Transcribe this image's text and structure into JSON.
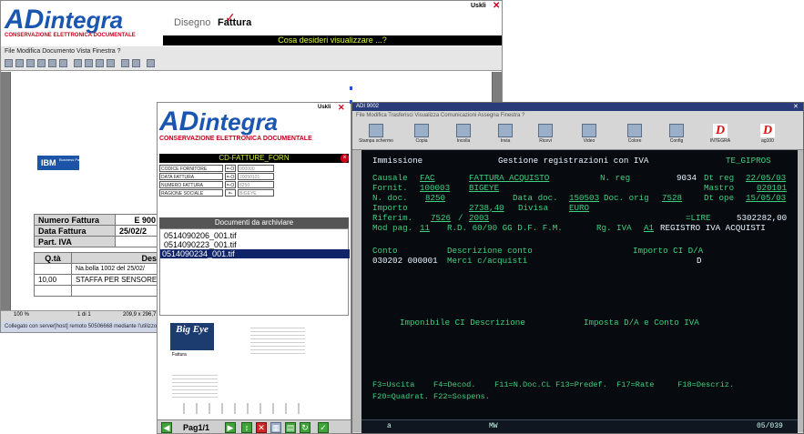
{
  "logo": {
    "brand_a": "AD",
    "brand_b": "integra",
    "tagline": "CONSERVAZIONE ELETTRONICA DOCUMENTALE"
  },
  "viewer": {
    "close_label": "Uskli",
    "tab_disegno": "Disegno",
    "tab_fattura": "Fattura",
    "prompt": "Cosa desideri visualizzare ...?",
    "menu": "File  Modifica  Documento  Vista  Finestra  ?",
    "zoom": "100 %",
    "page_counter": "1 di 1",
    "page_size": "209,9 x 296,7 mm",
    "status": "Collegato con server[host] remoto 50506668 mediante l'utilizzo del",
    "company_logo": "IBM",
    "company_sub": "Business Partner",
    "invoice": {
      "numero_label": "Numero Fattura",
      "numero_value": "E 900",
      "data_label": "Data Fattura",
      "data_value": "25/02/2",
      "iva_label": "Part. IVA",
      "qta_header": "Q.tà",
      "desc_header": "Descri",
      "row1_desc": "Na.bolla  1002  del 25/02/",
      "row2_qty": "10,00",
      "row2_desc": "STAFFA PER SENSORE"
    }
  },
  "archive": {
    "close_label": "Uskli",
    "fields_title": "CD-FATTURE_FORN",
    "fields": [
      {
        "label": "CODICE FORNITORE",
        "op": "=-O",
        "value": "000000"
      },
      {
        "label": "DATA FATTURA",
        "op": "=-O",
        "value": "20050101"
      },
      {
        "label": "NUMERO FATTURA",
        "op": "=-O",
        "value": "8250"
      },
      {
        "label": "RAGIONE SOCIALE",
        "op": "=-",
        "value": "BIGEYE"
      }
    ],
    "docs_title": "Documenti da archiviare",
    "docs": [
      "0514090206_001.tif",
      "0514090223_001.tif",
      "0514090234_001.tif"
    ],
    "thumb_logo": "Big Eye",
    "thumb_sub": "Fattura",
    "pager": "Pag1/1"
  },
  "terminal": {
    "window_title": "ADI 9002",
    "menu": "File  Modifica  Trasferisci  Visualizza  Comunicazioni  Assegna  Finestra  ?",
    "tools": [
      "Stampa schermo",
      "Copia",
      "Incolla",
      "Invia",
      "Ricevi",
      "Video",
      "Colore",
      "Config",
      "INTEGRA",
      "ag100"
    ],
    "header_left": "Immissione",
    "header_center": "Gestione registrazioni con IVA",
    "header_right": "TE_GIPROS",
    "causale_label": "Causale",
    "causale_value": "FAC",
    "causale_desc": "FATTURA ACQUISTO",
    "nreg_label": "N. reg",
    "nreg_value": "9034",
    "dtreg_label": "Dt reg",
    "dtreg_value": "22/05/03",
    "fornit_label": "Fornit.",
    "fornit_code": "100003",
    "fornit_name": "BIGEYE",
    "mastro_label": "Mastro",
    "mastro_value": "020101",
    "ndoc_label": "N. doc.",
    "ndoc_value": "8250",
    "datadoc_label": "Data doc.",
    "datadoc_value": "150503",
    "docorig_label": "Doc. orig",
    "docorig_value": "7528",
    "dtope_label": "Dt ope",
    "dtope_value": "15/05/03",
    "importo_label": "Importo",
    "importo_value": "2738,40",
    "divisa_label": "Divisa",
    "divisa_value": "EURO",
    "riferim_label": "Riferim.",
    "riferim_a": "7526",
    "riferim_sep": "/",
    "riferim_b": "2003",
    "lire_label": "=LIRE",
    "lire_value": "5302282,00",
    "modpag_label": "Mod pag.",
    "modpag_value": "11",
    "modpag_desc": "R.D. 60/90 GG D.F. F.M.",
    "rgiva_label": "Rg. IVA",
    "rgiva_value": "A1",
    "rgiva_desc": "REGISTRO IVA ACQUISTI",
    "col_conto": "Conto",
    "col_desc": "Descrizione conto",
    "col_importo": "Importo CI D/A",
    "row_conto": "030202 000001",
    "row_desc": "Merci c/acquisti",
    "row_da": "D",
    "sub_header_left": "Imponibile CI Descrizione",
    "sub_header_right": "Imposta D/A e Conto IVA",
    "fkeys_1": "F3=Uscita    F4=Decod.    F11=N.Doc.CL F13=Predef.  F17=Rate     F18=Descriz.",
    "fkeys_2": "F20=Quadrat. F22=Sospens.",
    "status_left": "a",
    "status_mid": "MW",
    "status_right": "05/039"
  },
  "colors": {
    "brand_blue": "#1a56b0",
    "brand_red": "#c8001c",
    "term_bg": "#070b10",
    "term_green": "#3fd07f",
    "select_navy": "#10246a"
  }
}
